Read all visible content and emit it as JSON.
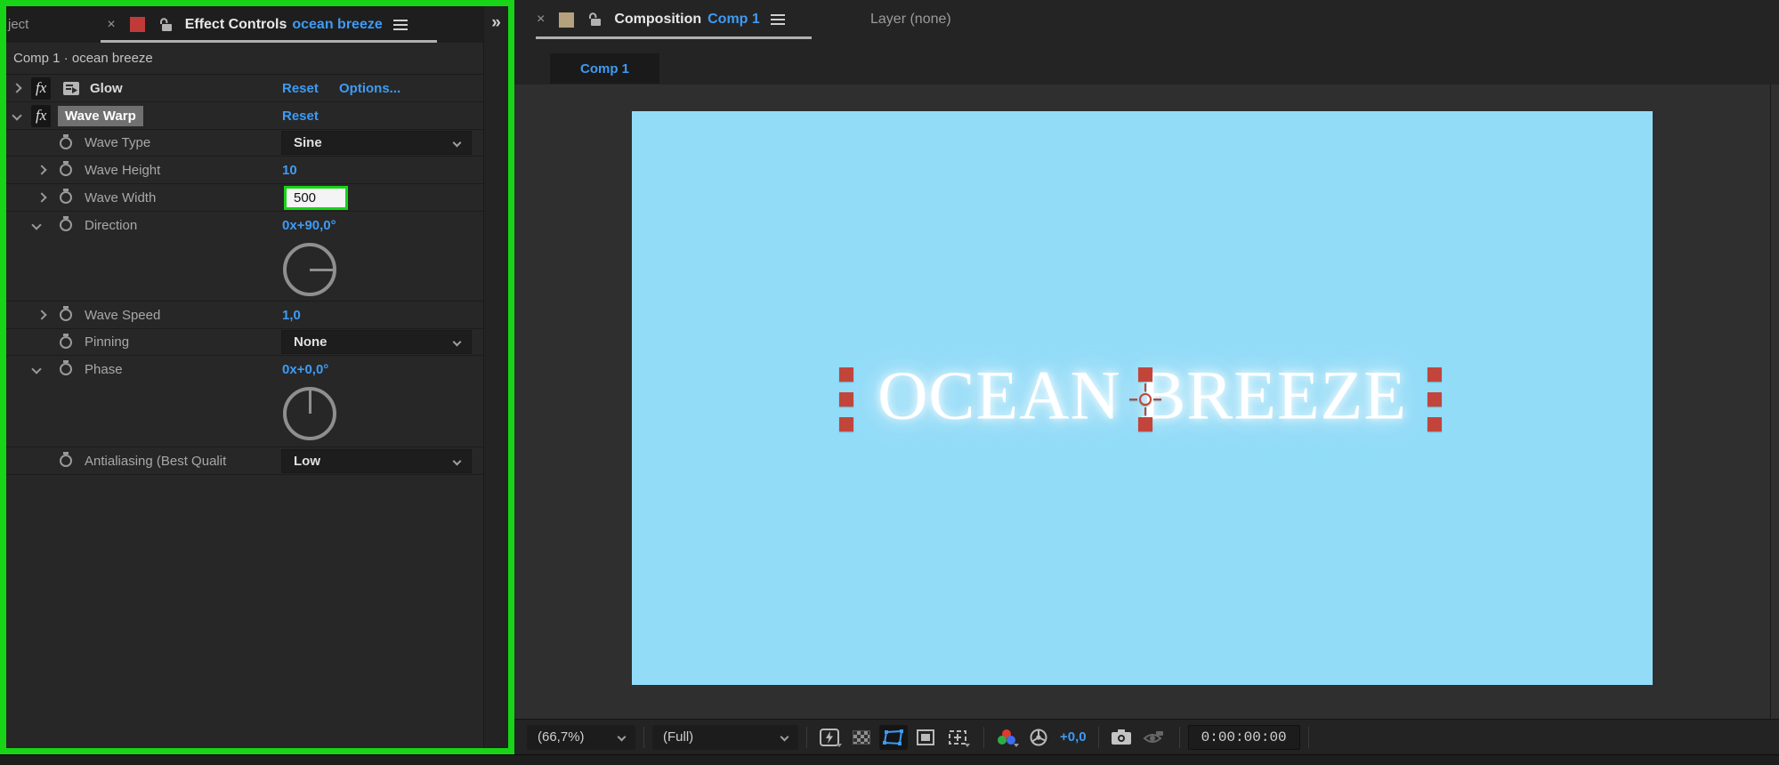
{
  "colors": {
    "accent_blue": "#3e9bf4",
    "capture_highlight_green": "#17d417",
    "comp_background_blue": "#93dcf8",
    "selection_handle_red": "#c2453c",
    "effect_controls_tab_square": "#c03a3a",
    "composition_tab_square": "#b5a27c"
  },
  "effect_controls": {
    "prev_tab_partial": "ject",
    "close_label": "×",
    "title": "Effect Controls",
    "target_name": "ocean breeze",
    "collapse_chevrons": "»",
    "breadcrumb": "Comp 1 · ocean breeze",
    "glow": {
      "name": "Glow",
      "reset": "Reset",
      "options": "Options..."
    },
    "wave_warp": {
      "name": "Wave Warp",
      "reset": "Reset"
    },
    "rows": {
      "wave_type": {
        "label": "Wave Type",
        "value": "Sine"
      },
      "wave_height": {
        "label": "Wave Height",
        "value": "10"
      },
      "wave_width": {
        "label": "Wave Width",
        "value": "500"
      },
      "direction": {
        "label": "Direction",
        "value": "0x+90,0°"
      },
      "wave_speed": {
        "label": "Wave Speed",
        "value": "1,0"
      },
      "pinning": {
        "label": "Pinning",
        "value": "None"
      },
      "phase": {
        "label": "Phase",
        "value": "0x+0,0°"
      },
      "antialiasing": {
        "label": "Antialiasing (Best Qualit",
        "value": "Low"
      }
    }
  },
  "composition": {
    "close_label": "×",
    "title": "Composition",
    "target_name": "Comp 1",
    "layer_tab": "Layer (none)",
    "viewer_tab": "Comp 1",
    "canvas_text": "OCEAN BREEZE"
  },
  "toolbar": {
    "magnification": "(66,7%)",
    "resolution": "(Full)",
    "exposure": "+0,0",
    "timecode": "0:00:00:00"
  }
}
